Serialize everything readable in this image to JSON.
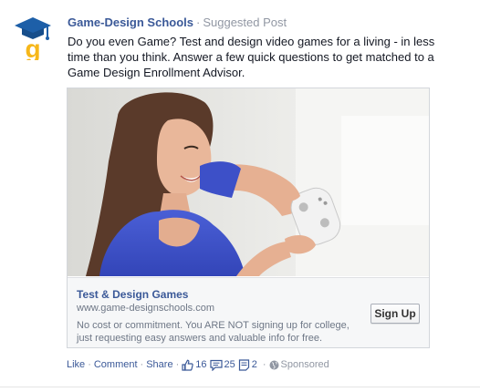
{
  "post": {
    "page_name": "Game-Design Schools",
    "separator": "·",
    "label": "Suggested Post",
    "body": "Do you even Game? Test and design video games for a living - in less time than you think. Answer a few quick questions to get matched to a Game Design Enrollment Advisor.",
    "avatar_icon": "graduation-cap-g-logo-icon",
    "brand_colors": {
      "cap": "#1d5fa8",
      "letter": "#f6b71a"
    }
  },
  "card": {
    "image_icon": "woman-playing-video-game-photo",
    "title": "Test & Design Games",
    "domain": "www.game-designschools.com",
    "description": "No cost or commitment. You ARE NOT signing up for college, just requesting easy answers and valuable info for free.",
    "cta_label": "Sign Up"
  },
  "actions": {
    "like": "Like",
    "comment": "Comment",
    "share": "Share",
    "dot": "·",
    "likes_count": "16",
    "comments_count": "25",
    "shares_count": "2",
    "sponsored": "Sponsored"
  },
  "colors": {
    "link": "#3b5998",
    "muted": "#9197a3"
  }
}
